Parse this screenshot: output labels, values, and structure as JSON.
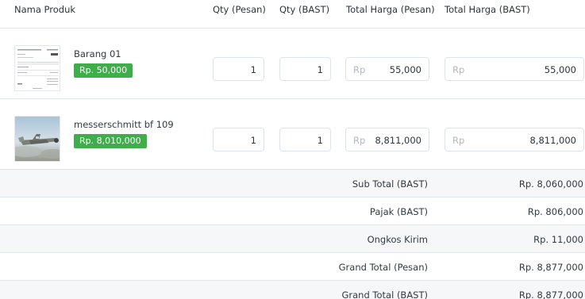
{
  "headers": {
    "product": "Nama Produk",
    "qty_order": "Qty (Pesan)",
    "qty_bast": "Qty (BAST)",
    "total_order": "Total Harga (Pesan)",
    "total_bast": "Total Harga (BAST)"
  },
  "items": [
    {
      "name": "Barang 01",
      "price": "Rp. 50,000",
      "qty_order": "1",
      "qty_bast": "1",
      "currency": "Rp",
      "total_order": "55,000",
      "total_bast": "55,000"
    },
    {
      "name": "messerschmitt bf 109",
      "price": "Rp. 8,010,000",
      "qty_order": "1",
      "qty_bast": "1",
      "currency": "Rp",
      "total_order": "8,811,000",
      "total_bast": "8,811,000"
    }
  ],
  "summary": [
    {
      "label": "Sub Total (BAST)",
      "value": "Rp. 8,060,000"
    },
    {
      "label": "Pajak (BAST)",
      "value": "Rp. 806,000"
    },
    {
      "label": "Ongkos Kirim",
      "value": "Rp. 11,000"
    },
    {
      "label": "Grand Total (Pesan)",
      "value": "Rp. 8,877,000"
    },
    {
      "label": "Grand Total (BAST)",
      "value": "Rp. 8,877,000"
    }
  ],
  "colors": {
    "badge": "#3fae4a",
    "border": "#dfe3ea",
    "row_alt": "#f6f7f9",
    "muted": "#b3b8bf"
  },
  "icons": {
    "item0": "document-thumbnail-image",
    "item1": "aircraft-photo-image"
  }
}
